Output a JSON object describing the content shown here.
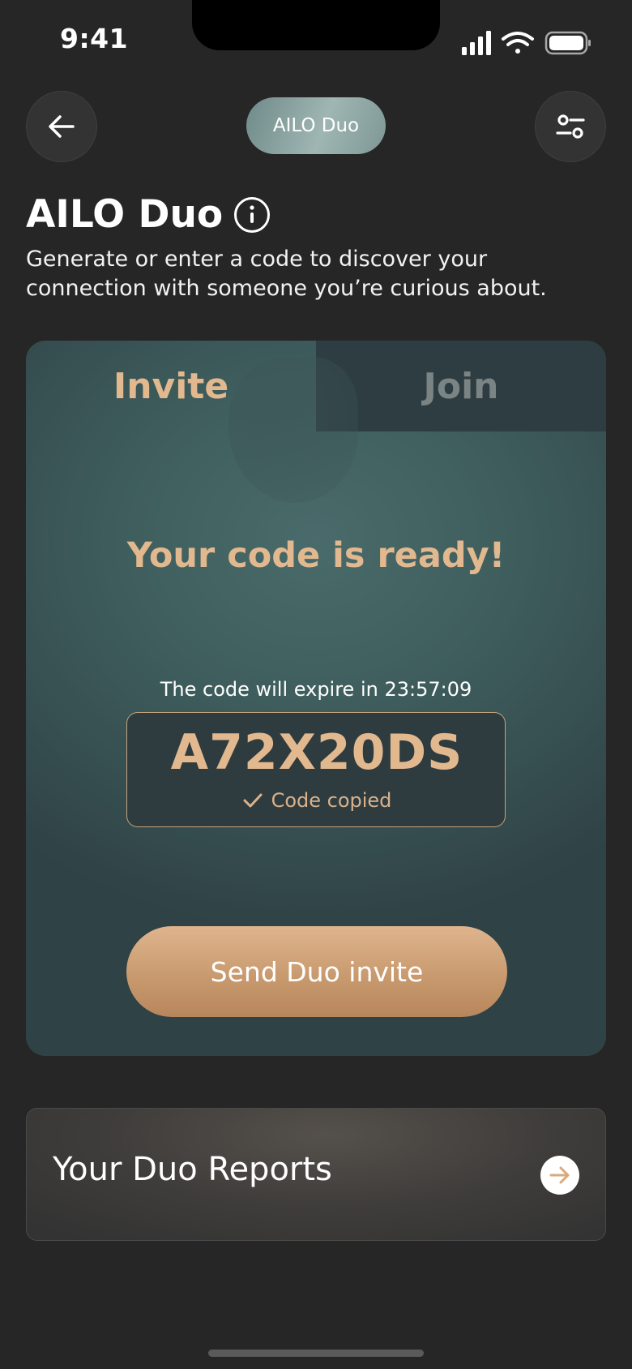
{
  "status_bar": {
    "time": "9:41"
  },
  "nav": {
    "back_icon": "arrow-left-icon",
    "pill_label": "AILO Duo",
    "settings_icon": "sliders-icon"
  },
  "header": {
    "title": "AILO Duo",
    "info_icon": "info-icon",
    "subtitle": "Generate or enter a code to discover your connection with someone you’re curious about."
  },
  "card": {
    "tabs": [
      {
        "label": "Invite",
        "active": true
      },
      {
        "label": "Join",
        "active": false
      }
    ],
    "ready_text": "Your code is ready!",
    "expire_prefix": "The code will expire in ",
    "expire_time": "23:57:09",
    "code": "A72X20DS",
    "copied_label": "Code copied",
    "send_button": "Send Duo invite"
  },
  "reports": {
    "label": "Your Duo Reports",
    "arrow_icon": "arrow-right-icon"
  },
  "colors": {
    "accent": "#e2b88f",
    "background": "#262626",
    "card": "#3e5c5c"
  }
}
